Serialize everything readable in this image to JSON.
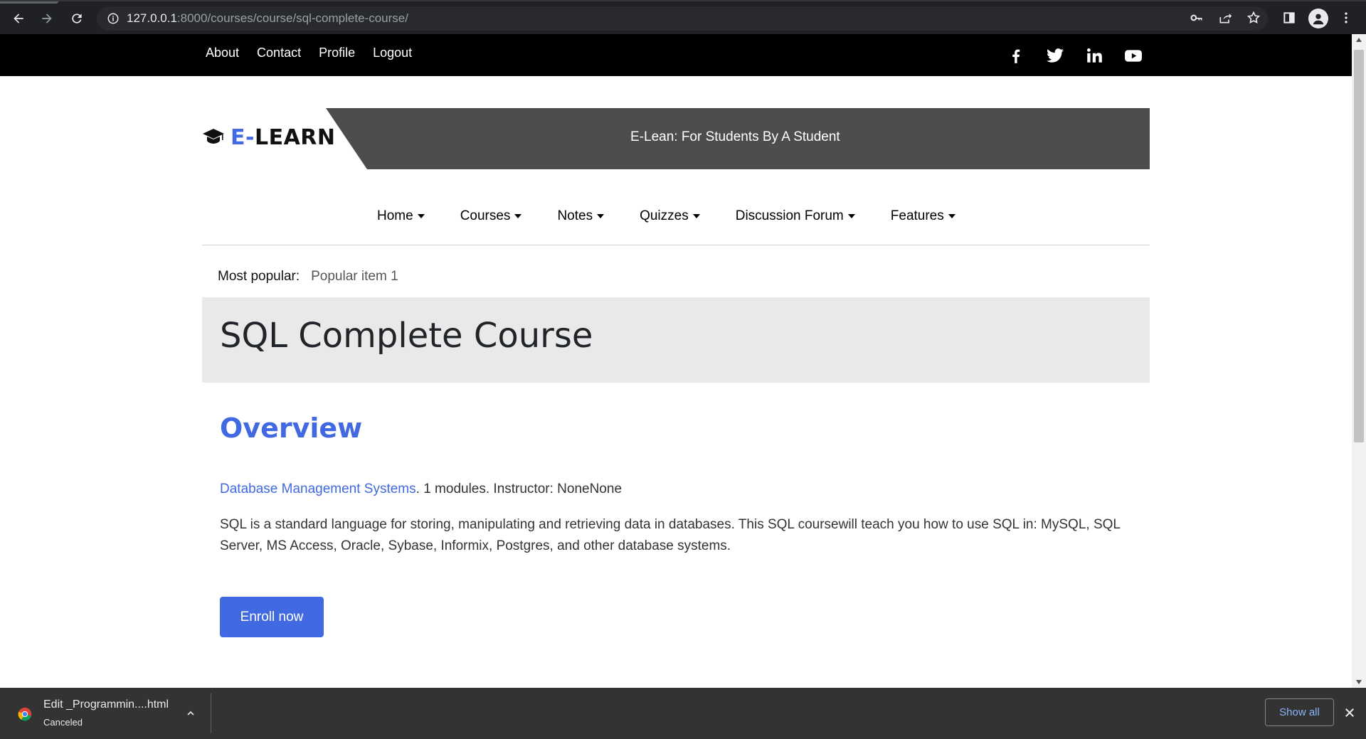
{
  "browser": {
    "url_host": "127.0.0.1",
    "url_path": ":8000/courses/course/sql-complete-course/"
  },
  "topbar": {
    "links": [
      "About",
      "Contact",
      "Profile",
      "Logout"
    ]
  },
  "brand": {
    "logo_prefix": "E-",
    "logo_name": "LEARN",
    "tagline": "E-Lean: For Students By A Student"
  },
  "nav": {
    "items": [
      "Home",
      "Courses",
      "Notes",
      "Quizzes",
      "Discussion Forum",
      "Features"
    ]
  },
  "popular": {
    "label": "Most popular:",
    "item": "Popular item 1"
  },
  "course": {
    "title": "SQL Complete Course",
    "overview_heading": "Overview",
    "subject": "Database Management Systems",
    "meta": ". 1 modules. Instructor: NoneNone",
    "description": "SQL is a standard language for storing, manipulating and retrieving data in databases. This SQL coursewill teach you how to use SQL in: MySQL, SQL Server, MS Access, Oracle, Sybase, Informix, Postgres, and other database systems.",
    "enroll_label": "Enroll now"
  },
  "download_shelf": {
    "filename": "Edit _Programmin....html",
    "status": "Canceled",
    "show_all": "Show all"
  },
  "colors": {
    "accent": "#4169e1",
    "topbar_bg": "#000000",
    "banner_bg": "#4d4d4d",
    "hero_bg": "#e9e9e9",
    "chrome_bg": "#202124",
    "shelf_bg": "#333333"
  }
}
